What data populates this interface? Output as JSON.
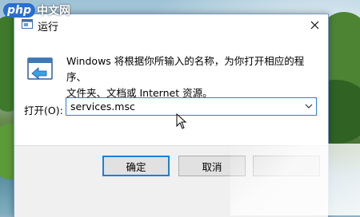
{
  "watermark": {
    "logo": "php",
    "text": "中文网"
  },
  "window": {
    "title": "运行",
    "icon": "run-icon"
  },
  "description": {
    "line1": "Windows 将根据你所输入的名称，为你打开相应的程序、",
    "line2": "文件夹、文档或 Internet 资源。"
  },
  "open": {
    "label": "打开(O):",
    "value": "services.msc"
  },
  "buttons": {
    "ok": "确定",
    "cancel": "取消"
  },
  "colors": {
    "accent": "#1e7fd8",
    "footer": "#f0f0f0"
  }
}
